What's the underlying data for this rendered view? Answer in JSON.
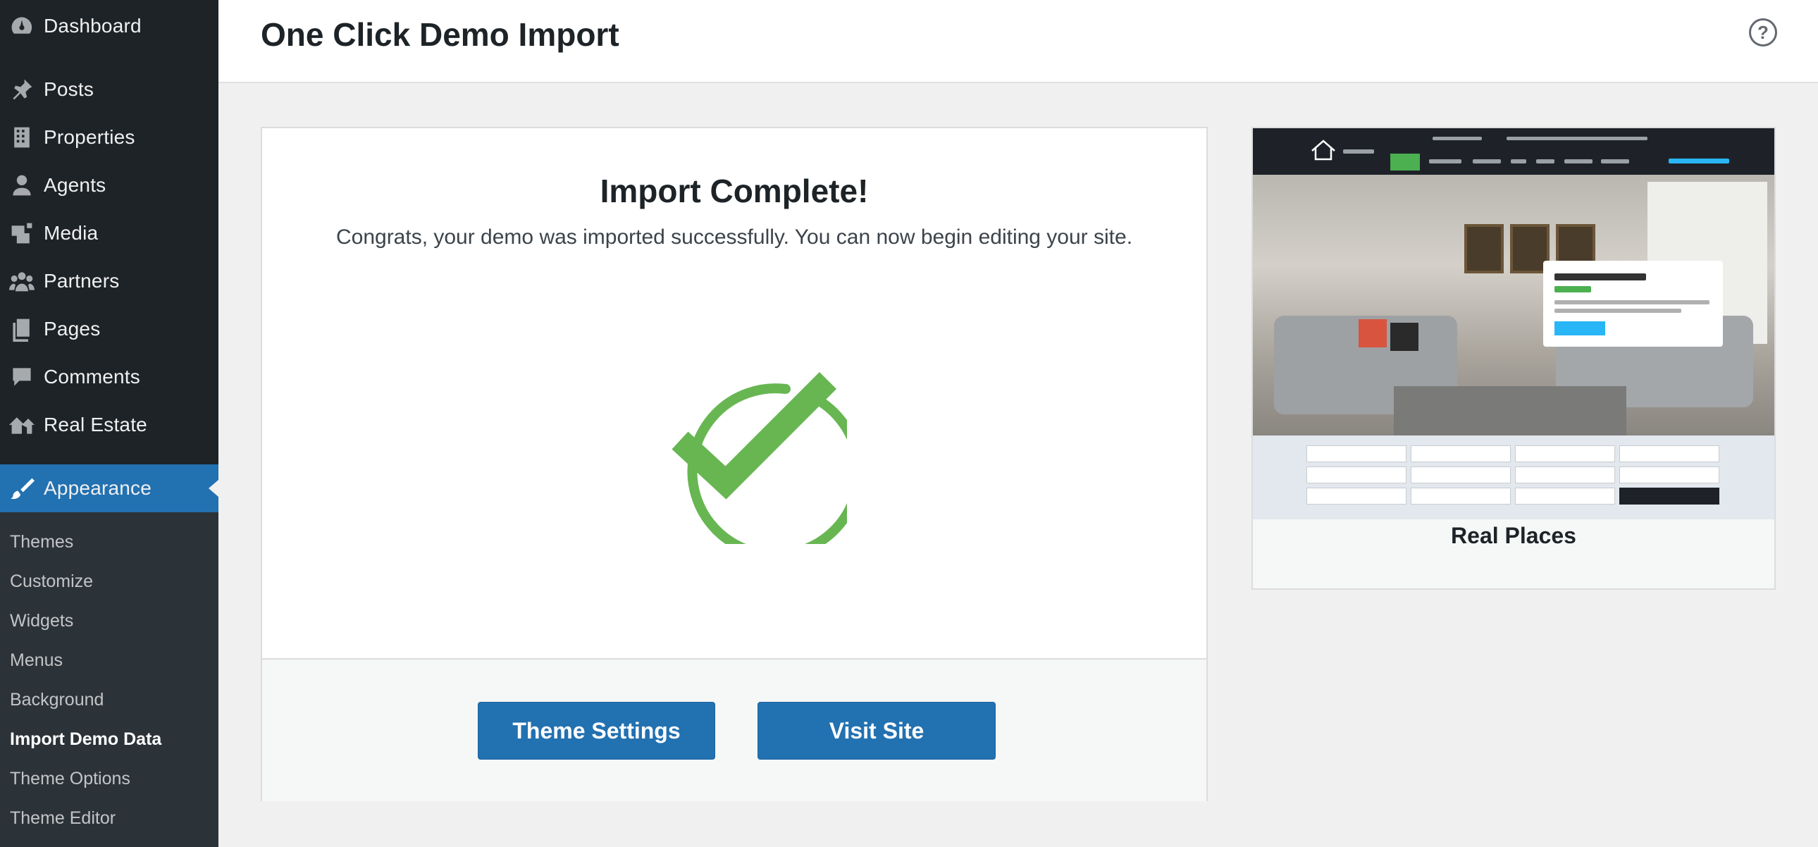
{
  "sidebar": {
    "menu": [
      {
        "label": "Dashboard",
        "icon": "dashboard-icon"
      },
      {
        "label": "Posts",
        "icon": "pin-icon"
      },
      {
        "label": "Properties",
        "icon": "building-icon"
      },
      {
        "label": "Agents",
        "icon": "user-icon"
      },
      {
        "label": "Media",
        "icon": "media-icon"
      },
      {
        "label": "Partners",
        "icon": "groups-icon"
      },
      {
        "label": "Pages",
        "icon": "pages-icon"
      },
      {
        "label": "Comments",
        "icon": "comment-icon"
      },
      {
        "label": "Real Estate",
        "icon": "houses-icon"
      },
      {
        "label": "Appearance",
        "icon": "brush-icon"
      }
    ],
    "submenu": [
      {
        "label": "Themes"
      },
      {
        "label": "Customize"
      },
      {
        "label": "Widgets"
      },
      {
        "label": "Menus"
      },
      {
        "label": "Background"
      },
      {
        "label": "Import Demo Data"
      },
      {
        "label": "Theme Options"
      },
      {
        "label": "Theme Editor"
      }
    ],
    "active_color": "#2271b1"
  },
  "header": {
    "title": "One Click Demo Import",
    "help_label": "?"
  },
  "result": {
    "title": "Import Complete!",
    "message": "Congrats, your demo was imported successfully. You can now begin editing your site.",
    "status_icon": "checkmark-circle-icon",
    "status_color": "#67b652"
  },
  "actions": {
    "theme_settings": "Theme Settings",
    "visit_site": "Visit Site",
    "button_color": "#2271b1"
  },
  "demo": {
    "name": "Real Places"
  }
}
